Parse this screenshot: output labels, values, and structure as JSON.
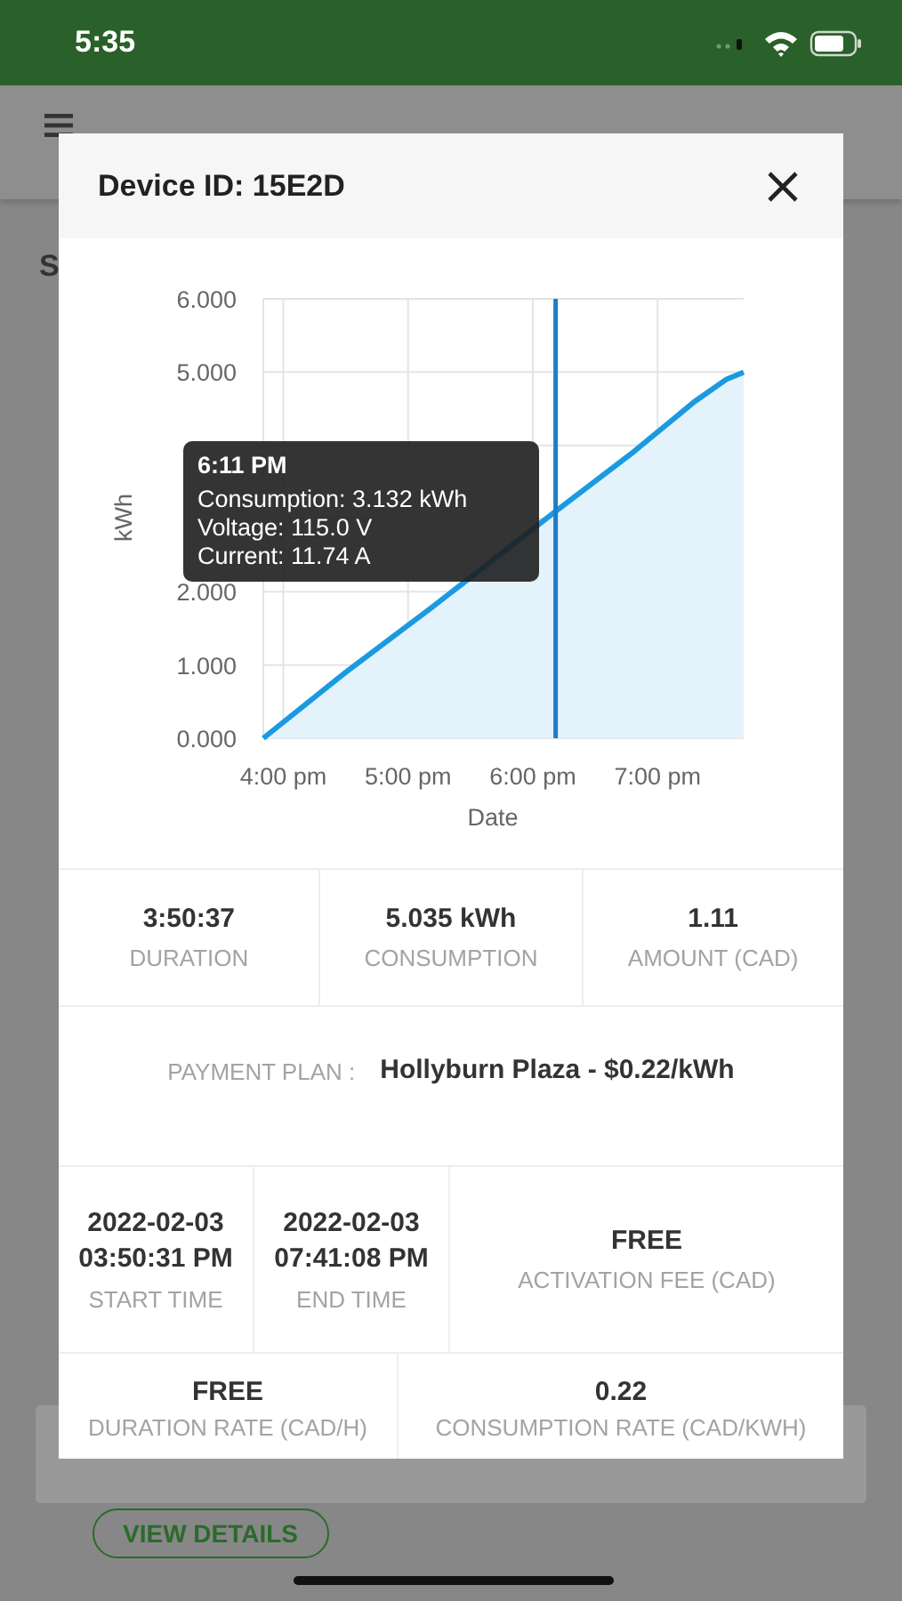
{
  "status_bar": {
    "time": "5:35"
  },
  "background": {
    "heading": "S",
    "button": "VIEW DETAILS"
  },
  "dialog": {
    "title": "Device ID: 15E2D",
    "chart_data": {
      "type": "area",
      "xlabel": "Date",
      "ylabel": "kWh",
      "grid": true,
      "x": [
        15.84,
        16.5,
        17.2,
        18.183,
        18.8,
        19.3,
        19.55,
        19.69
      ],
      "series": [
        {
          "color": "#1a9ae0",
          "values": [
            0,
            0.9,
            1.8,
            3.1,
            3.9,
            4.6,
            4.9,
            5.0
          ]
        }
      ],
      "xlim": [
        15.84,
        19.69
      ],
      "ylim": [
        0,
        6
      ],
      "xticks": [
        {
          "value": 16,
          "label": "4:00 pm"
        },
        {
          "value": 17,
          "label": "5:00 pm"
        },
        {
          "value": 18,
          "label": "6:00 pm"
        },
        {
          "value": 19,
          "label": "7:00 pm"
        }
      ],
      "yticks": [
        {
          "value": 0,
          "label": "0.000"
        },
        {
          "value": 1,
          "label": "1.000"
        },
        {
          "value": 2,
          "label": "2.000"
        },
        {
          "value": 5,
          "label": "5.000"
        },
        {
          "value": 6,
          "label": "6.000"
        }
      ],
      "ref_lines": [
        {
          "axis": "x",
          "value": 18.183,
          "color": "#1b7fc4"
        }
      ]
    },
    "tooltip": {
      "title": "6:11 PM",
      "lines": [
        "Consumption: 3.132 kWh",
        "Voltage: 115.0 V",
        "Current: 11.74 A"
      ]
    },
    "stats": [
      {
        "value": "3:50:37",
        "label": "DURATION"
      },
      {
        "value": "5.035 kWh",
        "label": "CONSUMPTION"
      },
      {
        "value": "1.11",
        "label": "AMOUNT (CAD)"
      }
    ],
    "payment_plan": {
      "label": "PAYMENT PLAN :",
      "value": "Hollyburn Plaza - $0.22/kWh"
    },
    "times": [
      {
        "date": "2022-02-03",
        "time": "03:50:31 PM",
        "label": "START TIME"
      },
      {
        "date": "2022-02-03",
        "time": "07:41:08 PM",
        "label": "END TIME"
      }
    ],
    "activation_fee": {
      "value": "FREE",
      "label": "ACTIVATION FEE (CAD)"
    },
    "rates": [
      {
        "value": "FREE",
        "label": "DURATION RATE (CAD/H)"
      },
      {
        "value": "0.22",
        "label": "CONSUMPTION RATE (CAD/KWH)"
      }
    ]
  }
}
